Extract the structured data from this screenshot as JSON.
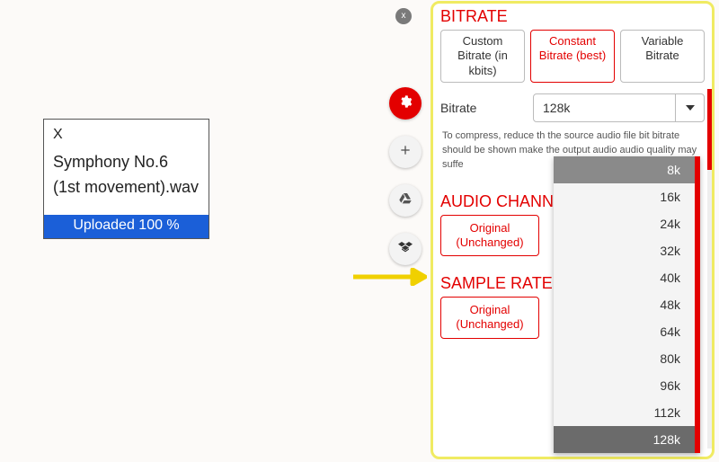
{
  "file": {
    "close": "X",
    "name": "Symphony No.6 (1st movement).wav",
    "status": "Uploaded 100 %"
  },
  "sections": {
    "bitrate_title": "BITRATE",
    "channels_title": "AUDIO CHANN",
    "sample_title": "SAMPLE RATE"
  },
  "tabs": {
    "custom": "Custom Bitrate (in kbits)",
    "constant": "Constant Bitrate (best)",
    "variable": "Variable Bitrate"
  },
  "bitrate": {
    "label": "Bitrate",
    "value": "128k",
    "options": [
      "8k",
      "16k",
      "24k",
      "32k",
      "40k",
      "48k",
      "64k",
      "80k",
      "96k",
      "112k",
      "128k"
    ],
    "help": "To compress, reduce th the source audio file bit bitrate should be shown make the output audio  audio quality may suffe"
  },
  "channels": {
    "original": "Original (Unchanged)"
  },
  "sample": {
    "original": "Original (Unchanged)"
  },
  "close_pill": "x"
}
